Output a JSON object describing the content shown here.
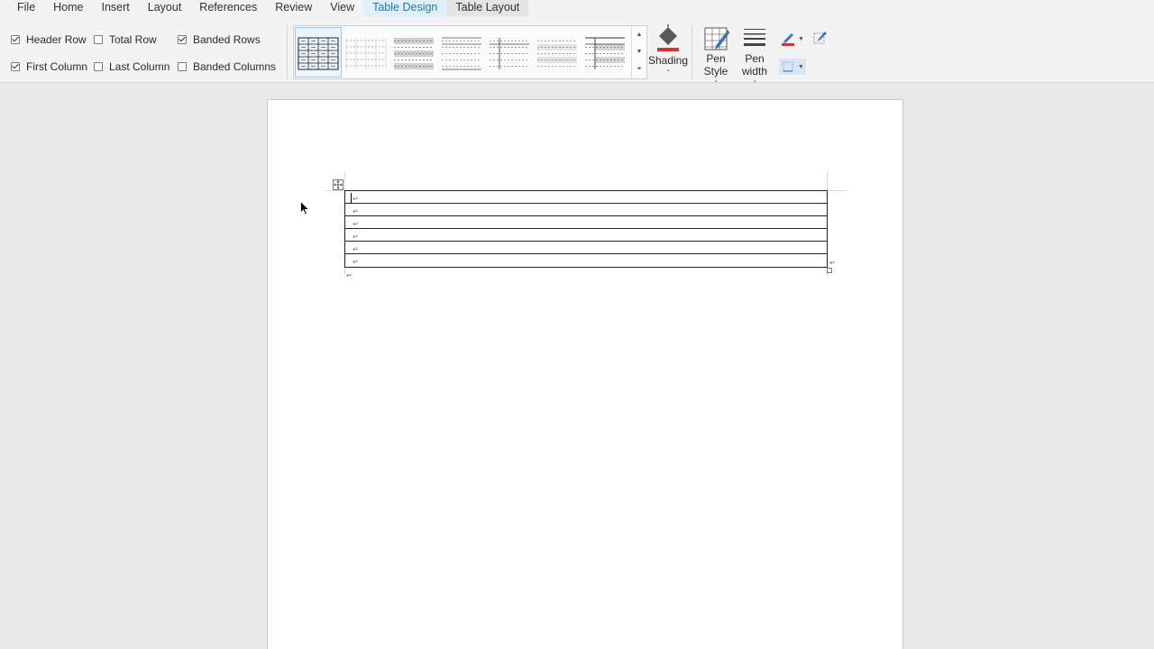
{
  "tabs": [
    "File",
    "Home",
    "Insert",
    "Layout",
    "References",
    "Review",
    "View",
    "Table Design",
    "Table Layout"
  ],
  "active_tab": "Table Design",
  "style_options": {
    "header_row": {
      "label": "Header Row",
      "checked": true
    },
    "total_row": {
      "label": "Total Row",
      "checked": false
    },
    "banded_rows": {
      "label": "Banded Rows",
      "checked": true
    },
    "first_column": {
      "label": "First Column",
      "checked": true
    },
    "last_column": {
      "label": "Last Column",
      "checked": false
    },
    "banded_columns": {
      "label": "Banded Columns",
      "checked": false
    }
  },
  "buttons": {
    "shading": "Shading",
    "pen_style_1": "Pen",
    "pen_style_2": "Style",
    "pen_width_1": "Pen",
    "pen_width_2": "width"
  },
  "colors": {
    "accent": "#1e77b8",
    "pen_color": "#d13438",
    "shading_color": "#d13438"
  },
  "icons": [
    "shading-bucket-icon",
    "pen-style-icon",
    "pen-width-icon",
    "pen-color-icon",
    "draw-table-icon",
    "borders-icon",
    "table-move-handle-icon",
    "paragraph-mark-icon",
    "mouse-cursor-icon"
  ],
  "document": {
    "table_rows": 6,
    "paragraph_mark": "↵"
  }
}
